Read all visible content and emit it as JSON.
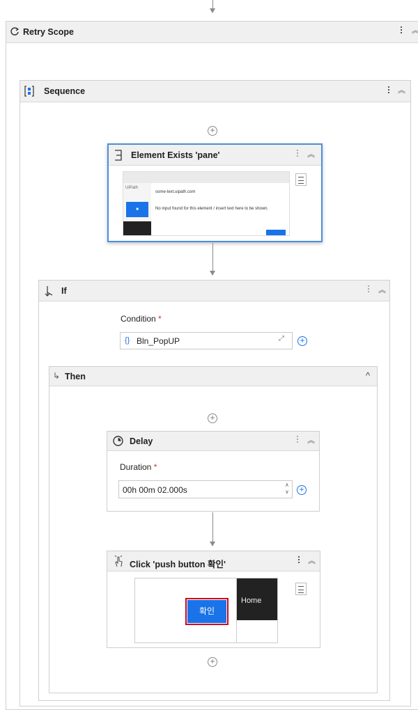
{
  "retry_scope": {
    "title": "Retry Scope"
  },
  "sequence": {
    "title": "Sequence"
  },
  "element_exists": {
    "title": "Element Exists 'pane'",
    "preview": {
      "url_text": "some-text.uipath.com",
      "body_text": "No input found for this element / insert text here to be shown.",
      "side_label": "UiPath",
      "blue_button_label": "OK"
    }
  },
  "if_activity": {
    "title": "If",
    "condition_label": "Condition",
    "required_mark": "*",
    "condition_value": "Bln_PopUP",
    "expr_icon": "{}"
  },
  "then_block": {
    "title": "Then"
  },
  "delay": {
    "title": "Delay",
    "duration_label": "Duration",
    "required_mark": "*",
    "duration_value": "00h 00m 02.000s"
  },
  "click_activity": {
    "title": "Click 'push button 확인'",
    "preview": {
      "button_label": "확인",
      "home_label": "Home"
    }
  },
  "colors": {
    "accent_blue": "#1a73e8",
    "selection_border": "#4a90d9",
    "highlight_red": "#d0021b",
    "header_gray": "#f0f0f0"
  }
}
